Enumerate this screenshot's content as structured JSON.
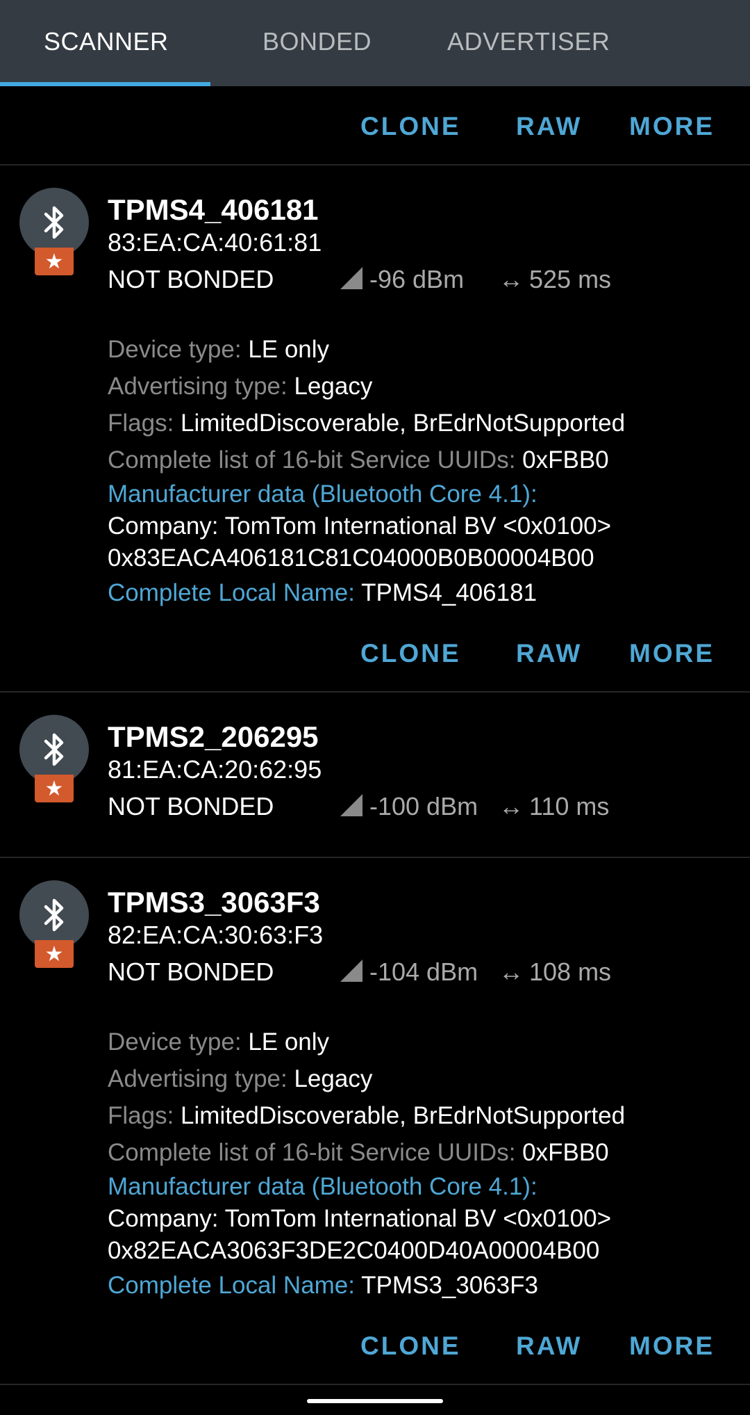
{
  "tabs": [
    {
      "label": "SCANNER",
      "active": true
    },
    {
      "label": "BONDED",
      "active": false
    },
    {
      "label": "ADVERTISER",
      "active": false
    }
  ],
  "actions": {
    "clone": "CLONE",
    "raw": "RAW",
    "more": "MORE"
  },
  "colors": {
    "tabbar": "#343b42",
    "accent": "#43a8e0",
    "link": "#4fa7d5",
    "badge": "#d25a2d",
    "avatar": "#424a52"
  },
  "badge_glyph": "★",
  "devices": [
    {
      "name": "TPMS4_406181",
      "address": "83:EA:CA:40:61:81",
      "bond_state": "NOT BONDED",
      "rssi": "-96 dBm",
      "interval": "525 ms",
      "device_type_label": "Device type: ",
      "device_type": "LE only",
      "adv_type_label": "Advertising type: ",
      "adv_type": "Legacy",
      "flags_label": "Flags: ",
      "flags": "LimitedDiscoverable, BrEdrNotSupported",
      "uuids_label": "Complete list of 16-bit Service UUIDs: ",
      "uuids": "0xFBB0",
      "mfr_label": "Manufacturer data (Bluetooth Core 4.1):",
      "mfr_company": "Company: TomTom International BV <0x0100>",
      "mfr_data": "0x83EACA406181C81C04000B0B00004B00",
      "local_name_label": "Complete Local Name: ",
      "local_name": "TPMS4_406181"
    },
    {
      "name": "TPMS2_206295",
      "address": "81:EA:CA:20:62:95",
      "bond_state": "NOT BONDED",
      "rssi": "-100 dBm",
      "interval": "110 ms"
    },
    {
      "name": "TPMS3_3063F3",
      "address": "82:EA:CA:30:63:F3",
      "bond_state": "NOT BONDED",
      "rssi": "-104 dBm",
      "interval": "108 ms",
      "device_type_label": "Device type: ",
      "device_type": "LE only",
      "adv_type_label": "Advertising type: ",
      "adv_type": "Legacy",
      "flags_label": "Flags: ",
      "flags": "LimitedDiscoverable, BrEdrNotSupported",
      "uuids_label": "Complete list of 16-bit Service UUIDs: ",
      "uuids": "0xFBB0",
      "mfr_label": "Manufacturer data (Bluetooth Core 4.1):",
      "mfr_company": "Company: TomTom International BV <0x0100>",
      "mfr_data": "0x82EACA3063F3DE2C0400D40A00004B00",
      "local_name_label": "Complete Local Name: ",
      "local_name": "TPMS3_3063F3"
    }
  ]
}
